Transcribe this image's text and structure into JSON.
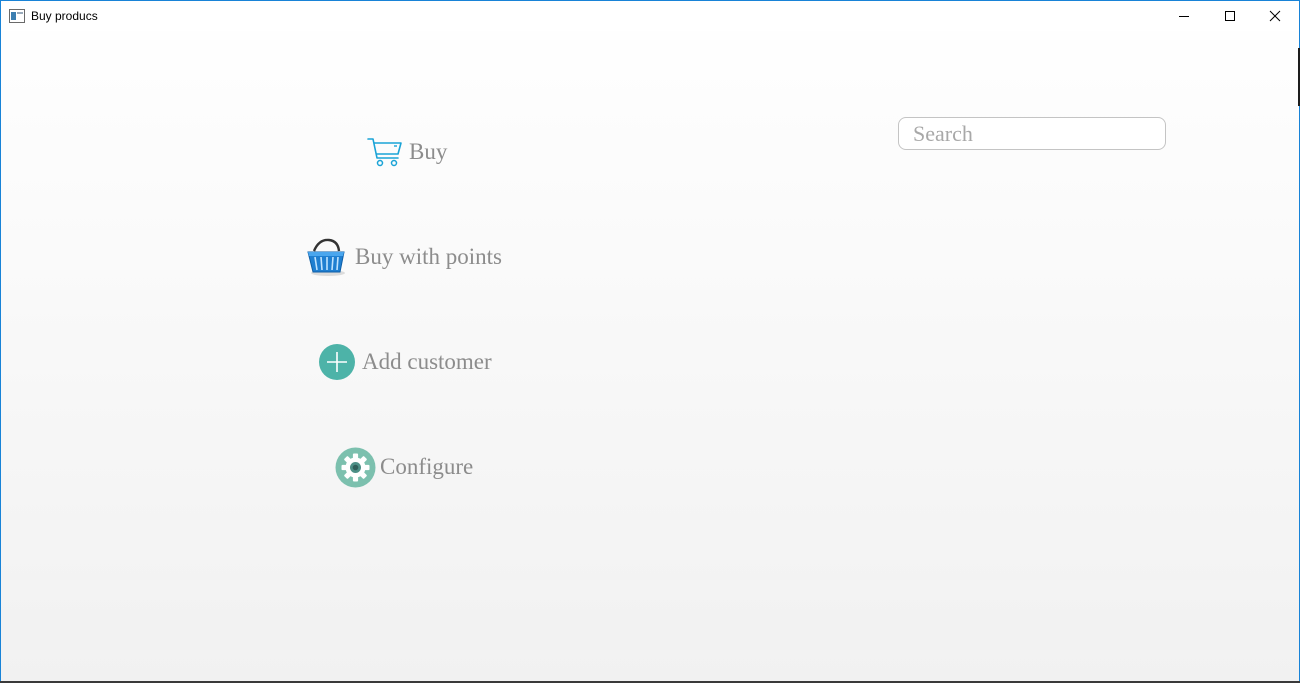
{
  "window": {
    "title": "Buy producs",
    "controls": {
      "minimize_icon": "minimize-icon",
      "maximize_icon": "maximize-icon",
      "close_icon": "close-icon"
    }
  },
  "menu": {
    "items": [
      {
        "label": "Buy",
        "icon": "shopping-cart-icon"
      },
      {
        "label": "Buy with points",
        "icon": "shopping-basket-icon"
      },
      {
        "label": "Add customer",
        "icon": "plus-circle-icon"
      },
      {
        "label": "Configure",
        "icon": "gear-icon"
      }
    ]
  },
  "search": {
    "placeholder": "Search",
    "value": ""
  },
  "colors": {
    "label_text": "#8c8c8c",
    "cart_blue": "#1aa3d6",
    "teal": "#4db3a8",
    "gear_teal": "#7cc0ae",
    "window_border": "#1883d7"
  }
}
